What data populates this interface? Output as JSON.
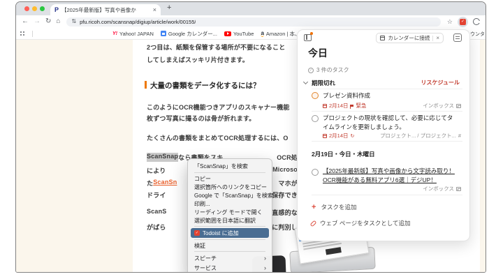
{
  "colors": {
    "accent_orange": "#ee7800",
    "todoist_red": "#dc4c3e",
    "overdue_red": "#c23b2e",
    "menu_highlight_blue": "#4a6d92",
    "page_beige": "#fbf6ec"
  },
  "browser": {
    "tab": {
      "favicon": "P",
      "title": "【2025年最新版】写真や画像か",
      "close": "×",
      "new_tab": "+"
    },
    "toolbar": {
      "back": "←",
      "forward": "→",
      "reload": "↻",
      "home": "⌂",
      "swap_icon": "⇅",
      "url": "pfu.ricoh.com/scansnap/digiup/article/work/00155/",
      "star": "☆",
      "todoist_check": "✓"
    },
    "bookmarks": {
      "items": [
        {
          "label": "Yahoo! JAPAN"
        },
        {
          "label": "Google カレンダー..."
        },
        {
          "label": "YouTube"
        },
        {
          "label": "Amazon | 本、フ"
        }
      ],
      "clipped_label": "ウンタ",
      "yahoo_glyph": "Y!",
      "amazon_glyph": "a"
    }
  },
  "page": {
    "para1_l1": "2つ目は、紙類を保管する場所が不要になること",
    "para1_l2": "してしまえばスッキリ片付きます。",
    "heading": "大量の書類をデータ化するには？",
    "para2_l1": "このようにOCR機能つきアプリのスキャナー機能",
    "para2_l2": "枚ずつ写真に撮るのは骨が折れます。",
    "para3_l1": "たくさんの書類をまとめてOCR処理するには、O",
    "para4": {
      "selected": "ScanSnap",
      "l1_rest": "なら書類をスキ",
      "l1_right": "OCR処",
      "l2_left": "により",
      "l2_right": "Microso",
      "l3_left": "た",
      "l3_link": "ScanSn",
      "l3_right": "マホが",
      "l4_left": "ドライ",
      "l4_right": "保存でき"
    },
    "para5": {
      "l1_left": "ScanS",
      "l1_right": "直感的な",
      "l2_left": "がばら",
      "l2_right": "に判別し"
    }
  },
  "context_menu": {
    "items": [
      {
        "label": "「ScanSnap」を検索"
      },
      {
        "label": "コピー"
      },
      {
        "label": "選択箇所へのリンクをコピー"
      },
      {
        "label": "Google で「ScanSnap」を検索"
      },
      {
        "label": "印刷..."
      },
      {
        "label": "リーディング モードで開く"
      },
      {
        "label": "選択範囲を日本語に翻訳"
      },
      {
        "label": "Todoist に追加",
        "selected": true
      },
      {
        "label": "検証"
      },
      {
        "label": "スピーチ",
        "submenu": true
      },
      {
        "label": "サービス",
        "submenu": true
      }
    ],
    "submenu_arrow": "›",
    "todoist_check": "✓"
  },
  "todoist": {
    "connect_button": "カレンダーに接続",
    "close": "×",
    "title": "今日",
    "count_icon": "✓",
    "task_count": "3 件のタスク",
    "overdue_label": "期限切れ",
    "reschedule": "リスケジュール",
    "tasks": [
      {
        "title": "プレゼン資料作成",
        "date": "2月14日",
        "priority": "緊急",
        "project": "インボックス"
      },
      {
        "line1": "プロジェクトの現状を確認して、必要に応じてタ",
        "line2": "イムラインを更新しましょう。",
        "date": "2月14日",
        "recur": "↻",
        "project": "プロジェクト... / プロジェクト...",
        "project_hash": "#"
      },
      {
        "line1": "【2025年最新版】写真や画像から文字読み取り！",
        "line2": "OCR機能がある無料アプリ6選｜デジUP！",
        "project": "インボックス"
      }
    ],
    "section2": "2月19日・今日・木曜日",
    "add_task": "タスクを追加",
    "add_page": "ウェブ ページをタスクとして追加"
  }
}
